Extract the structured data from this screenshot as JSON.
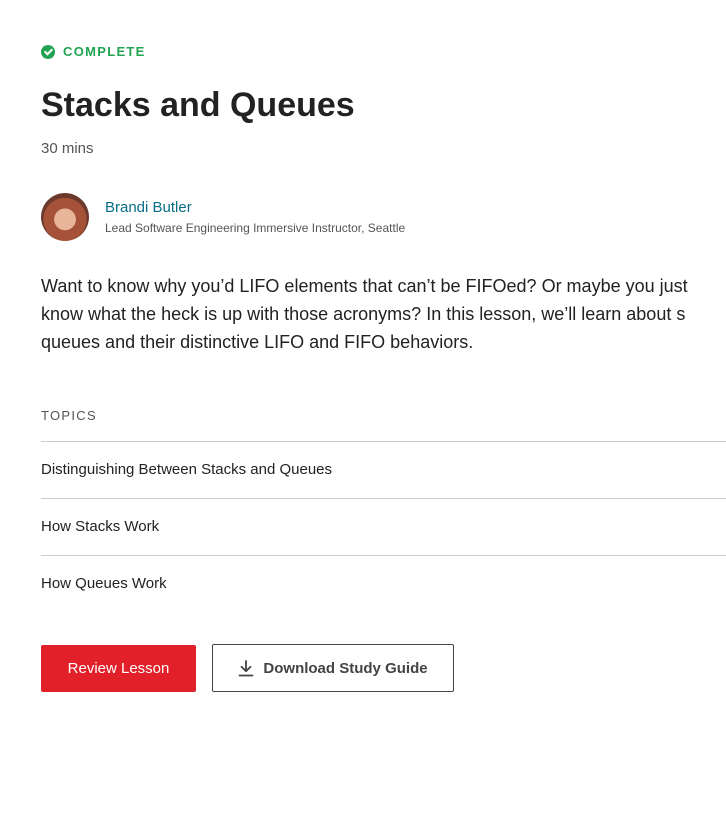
{
  "status": {
    "label": "COMPLETE",
    "icon": "check-circle-icon",
    "color": "#22a351"
  },
  "lesson": {
    "title": "Stacks and Queues",
    "duration": "30 mins",
    "description_lines": [
      "Want to know why you’d LIFO elements that can’t be FIFOed? Or maybe you just",
      "know what the heck is up with those acronyms? In this lesson, we’ll learn about s",
      "queues and their distinctive LIFO and FIFO behaviors."
    ]
  },
  "author": {
    "name": "Brandi Butler",
    "role": "Lead Software Engineering Immersive Instructor, Seattle",
    "name_color": "#0a6e86"
  },
  "topics": {
    "heading": "TOPICS",
    "items": [
      "Distinguishing Between Stacks and Queues",
      "How Stacks Work",
      "How Queues Work"
    ]
  },
  "actions": {
    "review_label": "Review Lesson",
    "review_color": "#e1202a",
    "download_label": "Download Study Guide",
    "download_icon": "download-icon"
  }
}
